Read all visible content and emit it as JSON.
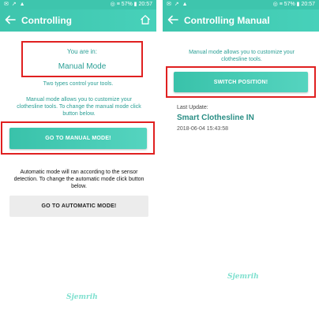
{
  "left": {
    "statusbar": {
      "left": "✉ ↗ ▲",
      "right": "◎ ≡ 57% ▮ 20:57"
    },
    "appbar": {
      "title": "Controlling"
    },
    "mode_box": {
      "you_are_in": "You are in:",
      "mode": "Manual Mode"
    },
    "two_types": "Two types control your tools.",
    "manual_desc": "Manual mode allows you to customize your clothesline tools. To change the manual mode click button below.",
    "manual_button": "GO TO MANUAL MODE!",
    "auto_desc": "Automatic mode will ran according to the sensor detection. To change the automatic mode click button below.",
    "auto_button": "GO TO AUTOMATIC MODE!",
    "logo": "Sjemrih"
  },
  "right": {
    "statusbar": {
      "left": "✉ ↗ ▲",
      "right": "◎ ≡ 57% ▮ 20:57"
    },
    "appbar": {
      "title": "Controlling Manual"
    },
    "manual_desc": "Manual mode allows you to customize your clothesline tools.",
    "switch_button": "SWITCH POSITION!",
    "last_update_label": "Last Update:",
    "device_status": "Smart Clothesline IN",
    "timestamp": "2018-06-04 15:43:58",
    "logo": "Sjemrih"
  },
  "colors": {
    "accent": "#3ec5ad",
    "highlight": "#e02020",
    "text": "#2a9f95"
  }
}
